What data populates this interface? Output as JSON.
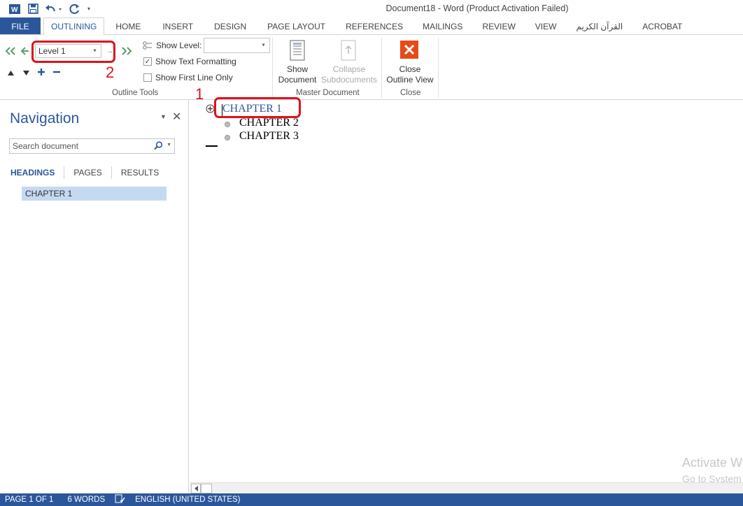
{
  "window": {
    "title": "Document18 - Word (Product Activation Failed)"
  },
  "qat": {
    "word_icon": "word-app-icon",
    "save_icon": "save-icon",
    "undo_icon": "undo-icon",
    "redo_icon": "redo-icon"
  },
  "tabs": [
    {
      "label": "FILE"
    },
    {
      "label": "OUTLINING"
    },
    {
      "label": "HOME"
    },
    {
      "label": "INSERT"
    },
    {
      "label": "DESIGN"
    },
    {
      "label": "PAGE LAYOUT"
    },
    {
      "label": "REFERENCES"
    },
    {
      "label": "MAILINGS"
    },
    {
      "label": "REVIEW"
    },
    {
      "label": "VIEW"
    },
    {
      "label": "القرآن الكريم"
    },
    {
      "label": "ACROBAT"
    }
  ],
  "ribbon": {
    "outline_tools": {
      "level_value": "Level 1",
      "show_level_label": "Show Level:",
      "show_level_value": "",
      "show_text_formatting_label": "Show Text Formatting",
      "show_text_formatting_checked": true,
      "show_first_line_label": "Show First Line Only",
      "show_first_line_checked": false,
      "group_label": "Outline Tools"
    },
    "master_document": {
      "show_document_label": "Show Document",
      "collapse_subdocuments_label": "Collapse Subdocuments",
      "group_label": "Master Document"
    },
    "close": {
      "close_outline_label": "Close Outline View",
      "group_label": "Close"
    }
  },
  "navigation": {
    "title": "Navigation",
    "search_placeholder": "Search document",
    "tabs": [
      "HEADINGS",
      "PAGES",
      "RESULTS"
    ],
    "active_tab": "HEADINGS",
    "headings": [
      "CHAPTER 1"
    ]
  },
  "document": {
    "lines": [
      {
        "text": "CHAPTER 1",
        "level": 1
      },
      {
        "text": "CHAPTER 2",
        "level": 2
      },
      {
        "text": "CHAPTER 3",
        "level": 2
      }
    ]
  },
  "annotations": {
    "one": "1",
    "two": "2"
  },
  "watermark": {
    "line1": "Activate W",
    "line2": "Go to System"
  },
  "status": {
    "page": "PAGE 1 OF 1",
    "words": "6 WORDS",
    "language": "ENGLISH (UNITED STATES)"
  },
  "colors": {
    "accent": "#2b579a",
    "annotation_red": "#e0101a",
    "nav_highlight": "#c5d9f1"
  }
}
